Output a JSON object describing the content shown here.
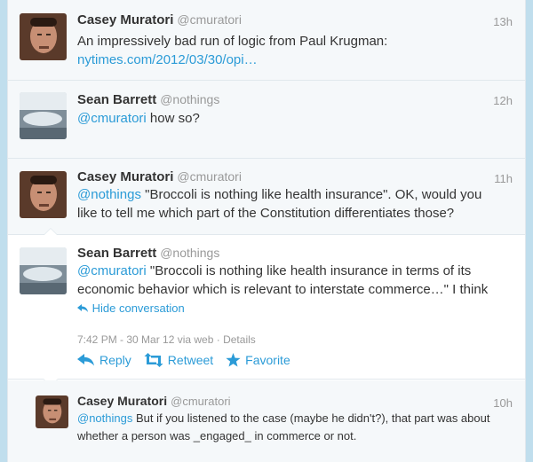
{
  "tweets": [
    {
      "name": "Casey Muratori",
      "handle": "@cmuratori",
      "time": "13h",
      "text": "An impressively bad run of logic from Paul Krugman: ",
      "link": "nytimes.com/2012/03/30/opi…"
    },
    {
      "name": "Sean Barrett",
      "handle": "@nothings",
      "time": "12h",
      "mention": "@cmuratori",
      "text": " how so?"
    },
    {
      "name": "Casey Muratori",
      "handle": "@cmuratori",
      "time": "11h",
      "mention": "@nothings",
      "text": " \"Broccoli is nothing like health insurance\". OK, would you like to tell me which part of the Constitution differentiates those?"
    },
    {
      "name": "Sean Barrett",
      "handle": "@nothings",
      "mention": "@cmuratori",
      "text": " \"Broccoli is nothing like health insurance in terms of its economic behavior which is relevant to interstate commerce…\" I think",
      "hide_conversation": "Hide conversation",
      "timestamp": "7:42 PM - 30 Mar 12 via web",
      "details": "Details",
      "reply": "Reply",
      "retweet": "Retweet",
      "favorite": "Favorite"
    },
    {
      "name": "Casey Muratori",
      "handle": "@cmuratori",
      "time": "10h",
      "mention": "@nothings",
      "text": " But if you listened to the case (maybe he didn't?), that part was about whether a person was _engaged_ in commerce or not."
    }
  ],
  "colors": {
    "link": "#2b9bd7",
    "background": "#c0deed"
  },
  "icons": [
    "reply-arrow-icon",
    "retweet-icon",
    "favorite-star-icon",
    "back-arrow-icon"
  ]
}
